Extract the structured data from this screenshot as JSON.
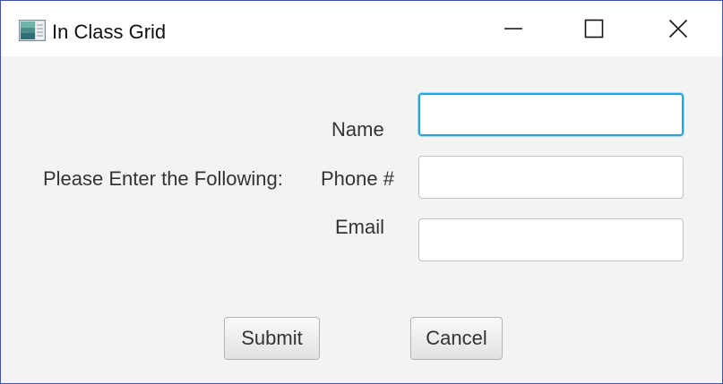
{
  "window": {
    "title": "In Class Grid",
    "icon": "app-window-icon",
    "controls": {
      "minimize_icon": "minimize-icon",
      "maximize_icon": "maximize-icon",
      "close_icon": "close-icon"
    }
  },
  "form": {
    "prompt": "Please Enter the Following:",
    "fields": [
      {
        "label": "Name",
        "value": "",
        "focused": true
      },
      {
        "label": "Phone #",
        "value": ""
      },
      {
        "label": "Email",
        "value": ""
      }
    ],
    "buttons": {
      "submit": "Submit",
      "cancel": "Cancel"
    }
  },
  "colors": {
    "window_border": "#3b54b6",
    "content_background": "#f3f3f3",
    "focus_ring": "#2aa3d6"
  }
}
